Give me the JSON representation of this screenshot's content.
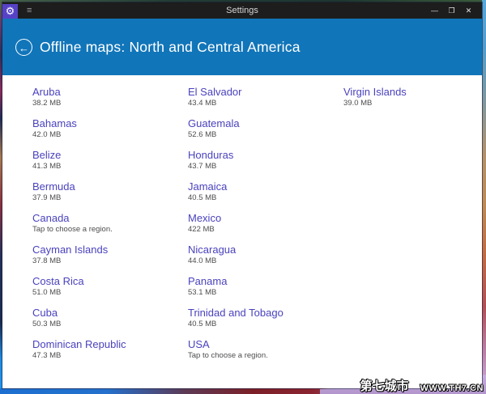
{
  "window": {
    "title": "Settings",
    "titlebar": {
      "app_icon_glyph": "⚙",
      "menu_icon_glyph": "≡",
      "minimize_glyph": "—",
      "maximize_glyph": "❐",
      "close_glyph": "✕"
    },
    "header": {
      "back_icon_glyph": "←",
      "title": "Offline maps: North and Central America"
    }
  },
  "colors": {
    "titlebar_bg": "#1d1d1d",
    "app_icon_bg": "#5642c6",
    "header_blue": "#1175b9",
    "region_link_purple": "#4a42bd",
    "detail_gray": "#4d4d4d"
  },
  "maps": {
    "columns": [
      [
        {
          "name": "Aruba",
          "detail": "38.2 MB"
        },
        {
          "name": "Bahamas",
          "detail": "42.0 MB"
        },
        {
          "name": "Belize",
          "detail": "41.3 MB"
        },
        {
          "name": "Bermuda",
          "detail": "37.9 MB"
        },
        {
          "name": "Canada",
          "detail": "Tap to choose a region."
        },
        {
          "name": "Cayman Islands",
          "detail": "37.8 MB"
        },
        {
          "name": "Costa Rica",
          "detail": "51.0 MB"
        },
        {
          "name": "Cuba",
          "detail": "50.3 MB"
        },
        {
          "name": "Dominican Republic",
          "detail": "47.3 MB"
        }
      ],
      [
        {
          "name": "El Salvador",
          "detail": "43.4 MB"
        },
        {
          "name": "Guatemala",
          "detail": "52.6 MB"
        },
        {
          "name": "Honduras",
          "detail": "43.7 MB"
        },
        {
          "name": "Jamaica",
          "detail": "40.5 MB"
        },
        {
          "name": "Mexico",
          "detail": "422 MB"
        },
        {
          "name": "Nicaragua",
          "detail": "44.0 MB"
        },
        {
          "name": "Panama",
          "detail": "53.1 MB"
        },
        {
          "name": "Trinidad and Tobago",
          "detail": "40.5 MB"
        },
        {
          "name": "USA",
          "detail": "Tap to choose a region."
        }
      ],
      [
        {
          "name": "Virgin Islands",
          "detail": "39.0 MB"
        }
      ]
    ]
  },
  "watermark": {
    "site_name": "第七城市",
    "site_url": "WWW.TH7.CN"
  }
}
